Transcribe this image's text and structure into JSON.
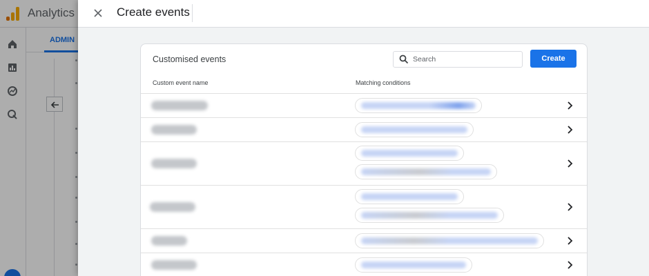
{
  "app": {
    "name": "Analytics",
    "admin_tab": "ADMIN",
    "brand_color": "#f9ab00",
    "accent_color": "#1a73e8"
  },
  "panel": {
    "title": "Create events",
    "close_icon": "close-icon"
  },
  "card": {
    "title": "Customised events",
    "search_placeholder": "Search",
    "search_value": "",
    "create_label": "Create",
    "columns": [
      "Custom event name",
      "Matching conditions"
    ],
    "rows_count_visible": 6
  }
}
